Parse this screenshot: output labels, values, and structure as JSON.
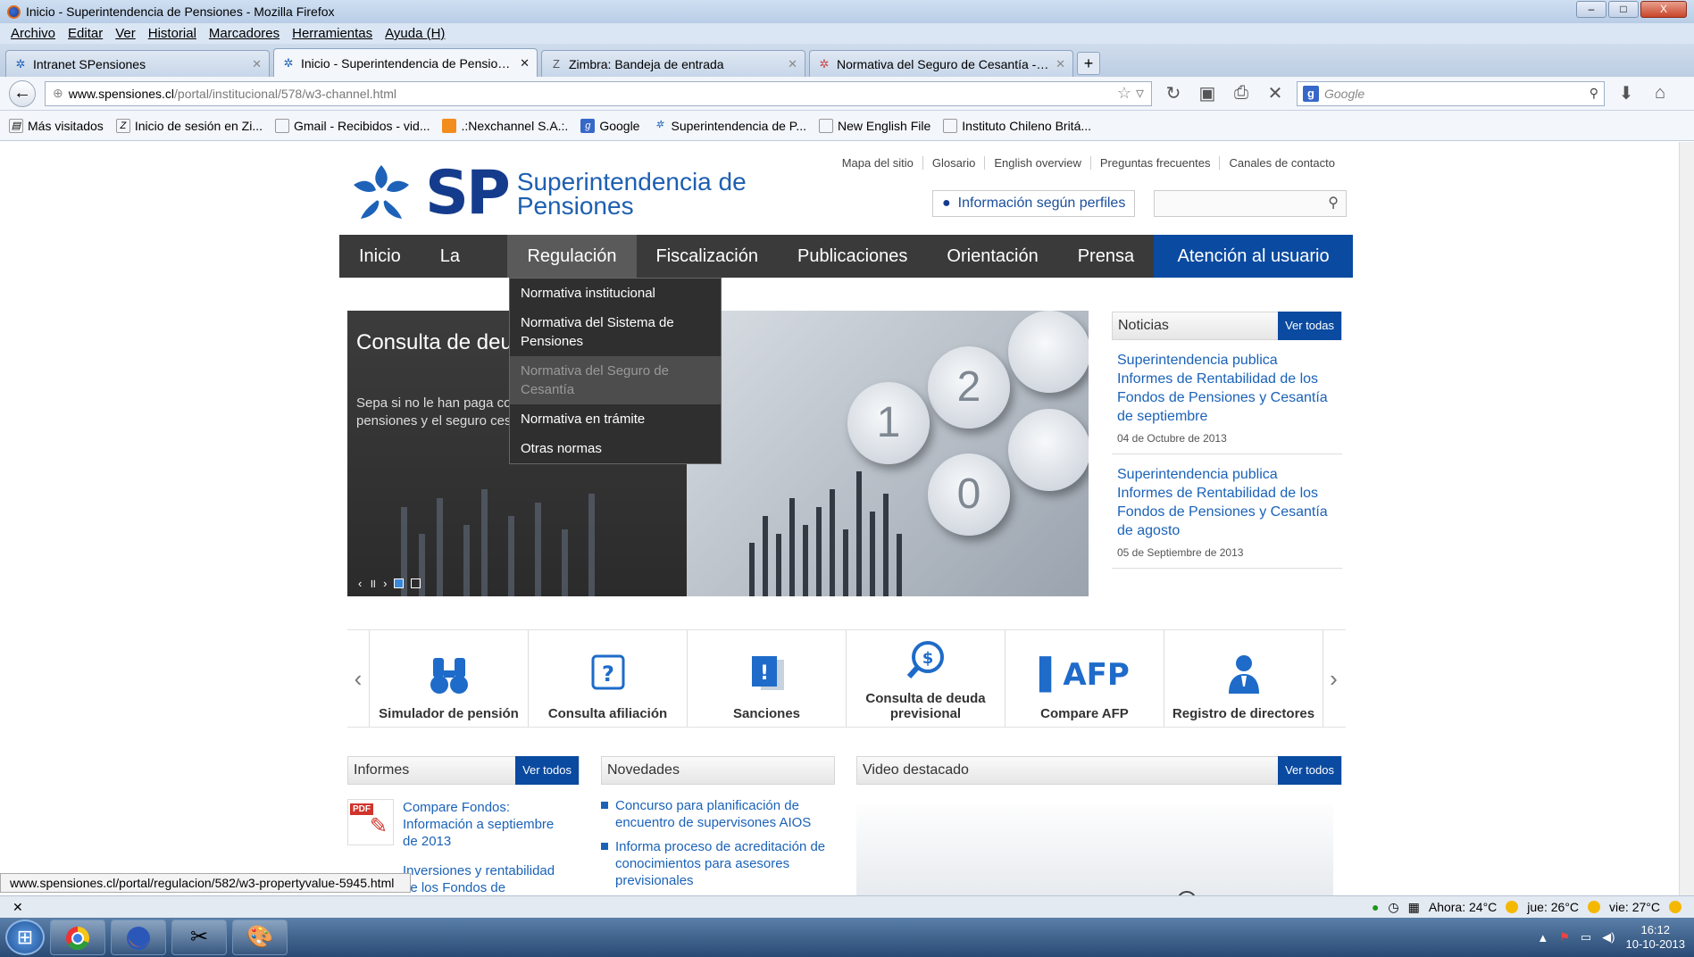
{
  "window": {
    "title": "Inicio - Superintendencia de Pensiones - Mozilla Firefox",
    "min": "–",
    "max": "□",
    "close": "X"
  },
  "menu": [
    "Archivo",
    "Editar",
    "Ver",
    "Historial",
    "Marcadores",
    "Herramientas",
    "Ayuda (H)"
  ],
  "tabs": [
    {
      "label": "Intranet SPensiones",
      "icon": "sp-icon",
      "active": false
    },
    {
      "label": "Inicio - Superintendencia de Pensiones",
      "icon": "sp-icon",
      "active": true
    },
    {
      "label": "Zimbra: Bandeja de entrada",
      "icon": "zimbra-icon",
      "active": false
    },
    {
      "label": "Normativa del Seguro de Cesantía - R...",
      "icon": "sp-icon",
      "active": false
    }
  ],
  "url": {
    "domain": "www.spensiones.cl",
    "path": "/portal/institucional/578/w3-channel.html"
  },
  "search": {
    "placeholder": "Google"
  },
  "bookmarks": [
    "Más visitados",
    "Inicio de sesión en Zi...",
    "Gmail - Recibidos - vid...",
    ".:Nexchannel S.A.:.",
    "Google",
    "Superintendencia de P...",
    "New English File",
    "Instituto Chileno Britá..."
  ],
  "site": {
    "logo_sp": "SP",
    "logo_name_1": "Superintendencia de",
    "logo_name_2": "Pensiones",
    "toplinks": [
      "Mapa del sitio",
      "Glosario",
      "English overview",
      "Preguntas frecuentes",
      "Canales de contacto"
    ],
    "perfiles": "Información según perfiles",
    "nav": [
      "Inicio",
      "La SP",
      "Regulación",
      "Fiscalización",
      "Publicaciones",
      "Orientación",
      "Prensa"
    ],
    "nav_atencion": "Atención al usuario",
    "dropdown": [
      "Normativa institucional",
      "Normativa del Sistema de Pensiones",
      "Normativa del Seguro de Cesantía",
      "Normativa en trámite",
      "Otras normas"
    ],
    "slide": {
      "title": "Consulta de deu previsional",
      "text": "Sepa si no le han paga cotizaciones en el siste pensiones y el seguro cesantía.",
      "keys": [
        "2",
        "1",
        "0"
      ]
    },
    "noticias": {
      "title": "Noticias",
      "ver": "Ver todas",
      "items": [
        {
          "title": "Superintendencia publica Informes de Rentabilidad de los Fondos de Pensiones y Cesantía de septiembre",
          "date": "04 de Octubre de 2013"
        },
        {
          "title": "Superintendencia publica Informes de Rentabilidad de los Fondos de Pensiones y Cesantía de agosto",
          "date": "05 de Septiembre de 2013"
        }
      ]
    },
    "shortcuts": [
      {
        "label": "Simulador de pensión",
        "icon": "binoculars-icon"
      },
      {
        "label": "Consulta afiliación",
        "icon": "question-icon"
      },
      {
        "label": "Sanciones",
        "icon": "exclamation-icon"
      },
      {
        "label": "Consulta de deuda previsional",
        "icon": "money-search-icon"
      },
      {
        "label": "Compare AFP",
        "icon": "afp-icon"
      },
      {
        "label": "Registro de directores",
        "icon": "director-icon"
      }
    ],
    "informes": {
      "title": "Informes",
      "ver": "Ver todos",
      "items": [
        "Compare Fondos: Información a septiembre de 2013",
        "Inversiones y rentabilidad de los Fondos de"
      ]
    },
    "novedades": {
      "title": "Novedades",
      "items": [
        "Concurso para planificación de encuentro de supervisones AIOS",
        "Informa proceso de acreditación de conocimientos para asesores previsionales"
      ]
    },
    "video": {
      "title": "Video destacado",
      "ver": "Ver todos"
    }
  },
  "status_url": "www.spensiones.cl/portal/regulacion/582/w3-propertyvalue-5945.html",
  "weather": {
    "now": "Ahora: 24°C",
    "thu": "jue: 26°C",
    "fri": "vie: 27°C"
  },
  "clock": {
    "time": "16:12",
    "date": "10-10-2013"
  }
}
